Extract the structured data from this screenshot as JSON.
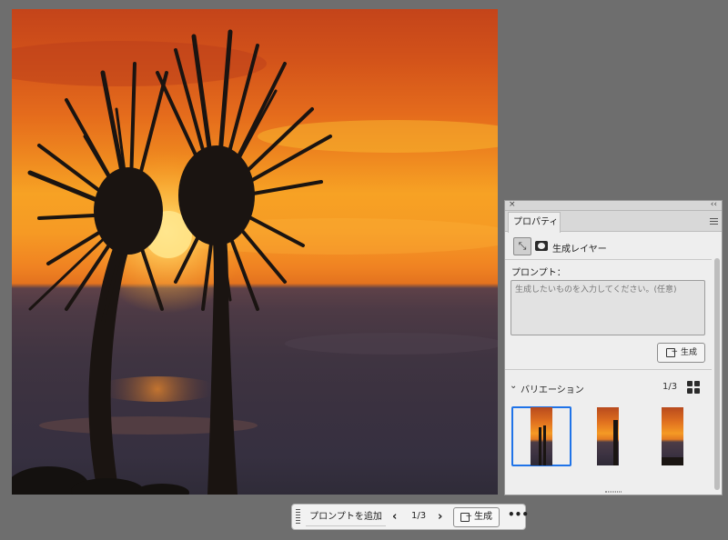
{
  "panel": {
    "close_glyph": "×",
    "collapse_glyph": "‹‹",
    "tab_label": "プロパティ",
    "layer_type_icon": "generative-layer-icon",
    "layer_type_glyph": "⤡",
    "layer_type_label": "生成レイヤー",
    "prompt_label": "プロンプト：",
    "prompt_placeholder": "生成したいものを入力してください。(任意)",
    "generate_label": "生成",
    "variations": {
      "chevron_glyph": "⌄",
      "label": "バリエーション",
      "count": "1/3",
      "selected_index": 0,
      "thumbnails": [
        "variation-1",
        "variation-2",
        "variation-3"
      ]
    }
  },
  "taskbar": {
    "add_prompt_label": "プロンプトを追加",
    "prev_glyph": "‹",
    "next_glyph": "›",
    "count": "1/3",
    "generate_label": "生成",
    "more_glyph": "•••"
  },
  "colors": {
    "accent": "#1f73e8",
    "app_background": "#6e6e6e",
    "panel_background": "#eeeeee"
  }
}
